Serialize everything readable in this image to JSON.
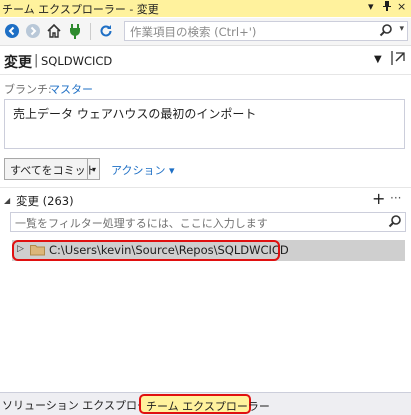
{
  "window": {
    "title": "チーム エクスプローラー - 変更",
    "dropdown_icon": "▾",
    "pin_icon": "ᵖ",
    "close_icon": "×"
  },
  "toolbar": {
    "search_placeholder": "作業項目の検索 (Ctrl+')"
  },
  "header": {
    "title": "変更",
    "separator": "|",
    "repo": "SQLDWCICD"
  },
  "branch": {
    "label": "ブランチ:",
    "name": "マスター"
  },
  "commit_message": "売上データ ウェアハウスの最初のインポート",
  "commit_button": {
    "label": "すべてをコミット",
    "arrow": "▾"
  },
  "actions_link": "アクション ▾",
  "changes": {
    "title": "変更 (263)",
    "filter_placeholder": "一覧をフィルター処理するには、ここに入力します",
    "items": [
      {
        "path": "C:\\Users\\kevin\\Source\\Repos\\SQLDWCICD"
      }
    ]
  },
  "bottom_tabs": [
    {
      "label": "ソリューション エクスプローラー"
    },
    {
      "label": "チーム エクスプローラー"
    }
  ],
  "colors": {
    "title_bg": "#fff29d",
    "link": "#1e6fc5",
    "highlight": "#e01010"
  }
}
